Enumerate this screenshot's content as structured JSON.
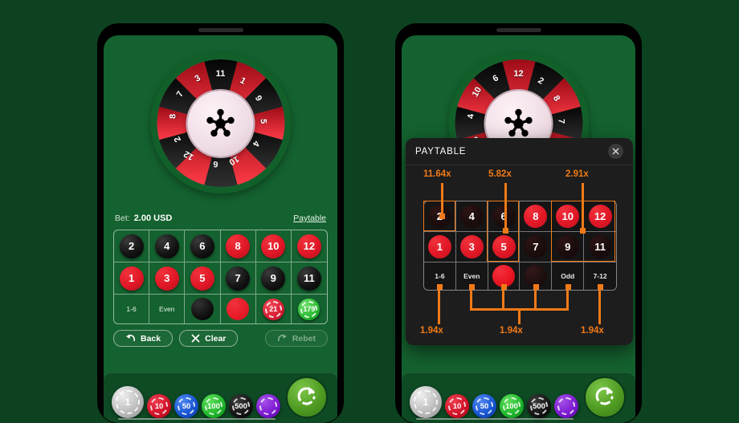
{
  "app": {
    "background_color": "#0d4220",
    "table_color": "#14622f",
    "accent_orange": "#f07a18"
  },
  "wheel": {
    "segments": [
      {
        "number": "11",
        "color": "black"
      },
      {
        "number": "1",
        "color": "red"
      },
      {
        "number": "9",
        "color": "black"
      },
      {
        "number": "5",
        "color": "red"
      },
      {
        "number": "4",
        "color": "black"
      },
      {
        "number": "10",
        "color": "red"
      },
      {
        "number": "6",
        "color": "black"
      },
      {
        "number": "12",
        "color": "red"
      },
      {
        "number": "2",
        "color": "black"
      },
      {
        "number": "8",
        "color": "red"
      },
      {
        "number": "7",
        "color": "black"
      },
      {
        "number": "3",
        "color": "red"
      }
    ],
    "left_rotation_deg": 0,
    "right_rotation_deg": 150,
    "hub_icon": "wheel-hub-star-icon"
  },
  "bet_bar": {
    "label": "Bet:",
    "value": "2.00 USD",
    "paytable_link": "Paytable"
  },
  "bet_grid": {
    "row_top": [
      {
        "label": "2",
        "color": "black"
      },
      {
        "label": "4",
        "color": "black"
      },
      {
        "label": "6",
        "color": "black"
      },
      {
        "label": "8",
        "color": "red"
      },
      {
        "label": "10",
        "color": "red"
      },
      {
        "label": "12",
        "color": "red"
      }
    ],
    "row_mid": [
      {
        "label": "1",
        "color": "red"
      },
      {
        "label": "3",
        "color": "red"
      },
      {
        "label": "5",
        "color": "red"
      },
      {
        "label": "7",
        "color": "black"
      },
      {
        "label": "9",
        "color": "black"
      },
      {
        "label": "11",
        "color": "black"
      }
    ],
    "row_bottom": [
      {
        "kind": "text",
        "label": "1-6"
      },
      {
        "kind": "text",
        "label": "Even"
      },
      {
        "kind": "swatch",
        "color": "black",
        "label": ""
      },
      {
        "kind": "swatch",
        "color": "red",
        "label": ""
      },
      {
        "kind": "chip",
        "color": "red",
        "label": "21"
      },
      {
        "kind": "chip",
        "color": "green",
        "label": "179"
      }
    ]
  },
  "actions": {
    "back": "Back",
    "clear": "Clear",
    "rebet": "Rebet",
    "rebet_disabled": true
  },
  "tray": {
    "chips": [
      {
        "value": "1",
        "color": "white",
        "selected": true
      },
      {
        "value": "10",
        "color": "red",
        "selected": false
      },
      {
        "value": "50",
        "color": "blue",
        "selected": false
      },
      {
        "value": "100",
        "color": "green",
        "selected": false
      },
      {
        "value": "500",
        "color": "black",
        "selected": false
      },
      {
        "value": "",
        "color": "purple",
        "selected": false
      }
    ],
    "spin_icon": "spin-refresh-icon"
  },
  "paytable": {
    "title": "PAYTABLE",
    "close_icon": "close-icon",
    "row_top": [
      {
        "label": "2",
        "color": "black"
      },
      {
        "label": "4",
        "color": "black"
      },
      {
        "label": "6",
        "color": "black"
      },
      {
        "label": "8",
        "color": "red"
      },
      {
        "label": "10",
        "color": "red"
      },
      {
        "label": "12",
        "color": "red"
      }
    ],
    "row_mid": [
      {
        "label": "1",
        "color": "red"
      },
      {
        "label": "3",
        "color": "red"
      },
      {
        "label": "5",
        "color": "red"
      },
      {
        "label": "7",
        "color": "black"
      },
      {
        "label": "9",
        "color": "black"
      },
      {
        "label": "11",
        "color": "black"
      }
    ],
    "row_bottom": [
      {
        "kind": "text",
        "label": "1-6"
      },
      {
        "kind": "text",
        "label": "Even"
      },
      {
        "kind": "swatch",
        "color": "red",
        "label": ""
      },
      {
        "kind": "swatch",
        "color": "black",
        "label": ""
      },
      {
        "kind": "text",
        "label": "Odd"
      },
      {
        "kind": "text",
        "label": "7-12"
      }
    ],
    "multipliers": {
      "single": "11.64x",
      "pair": "5.82x",
      "quad": "2.91x",
      "outside_left": "1.94x",
      "outside_mid": "1.94x",
      "outside_right": "1.94x"
    }
  }
}
